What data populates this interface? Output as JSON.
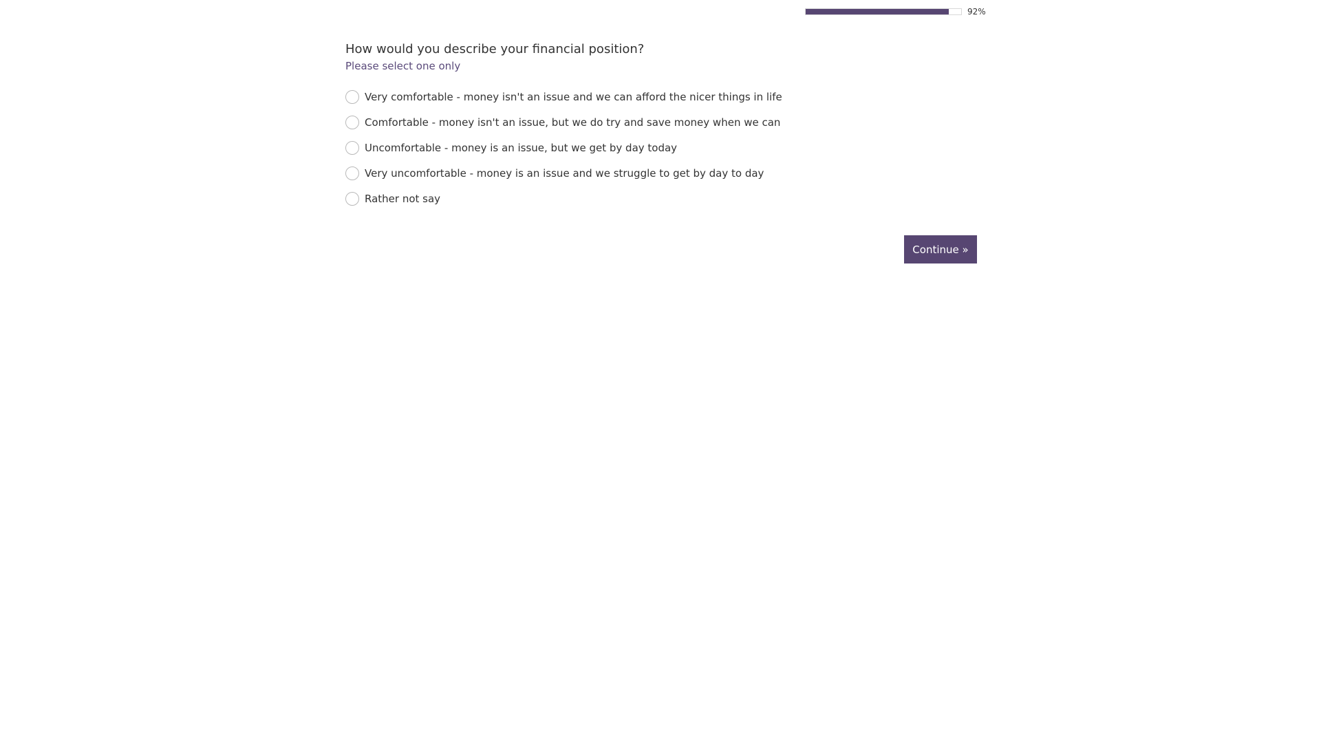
{
  "progress": {
    "value": 0.92,
    "label": "92%",
    "fill_color": "#574672"
  },
  "question": {
    "title": "How would you describe your financial position?",
    "instruction": "Please select one only",
    "options": [
      {
        "label": "Very comfortable - money isn't an issue and we can afford the nicer things in life",
        "selected": false
      },
      {
        "label": "Comfortable - money isn't an issue, but we do try and save money when we can",
        "selected": false
      },
      {
        "label": "Uncomfortable - money is an issue, but we get by day today",
        "selected": false
      },
      {
        "label": "Very uncomfortable - money is an issue and we struggle to get by day to day",
        "selected": false
      },
      {
        "label": "Rather not say",
        "selected": false
      }
    ]
  },
  "actions": {
    "continue_label": "Continue »"
  },
  "colors": {
    "accent": "#574672",
    "instruction_text": "#5a4a7a"
  }
}
